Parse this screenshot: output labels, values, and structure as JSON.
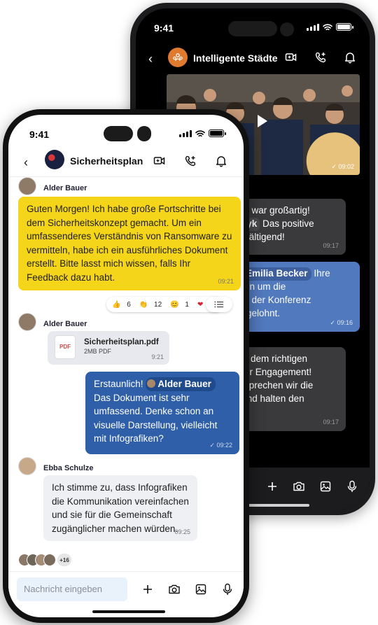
{
  "back_phone": {
    "status": {
      "time": "9:41"
    },
    "header": {
      "title": "Intelligente Städte"
    },
    "video": {
      "time": "09:02"
    },
    "messages": [
      {
        "line1": "enz war großartig!",
        "mention": "czyk",
        "line2_rest": "Das positive",
        "line3": "erwältigend!",
        "time": "09:17"
      },
      {
        "mention": "Emilia Becker",
        "line1_rest": "Ihre",
        "line2": "ngen um die",
        "line3": "tion der Konferenz",
        "line4": "ch gelohnt.",
        "time": "09:16"
      },
      {
        "line1": "Auf dem richtigen",
        "line2": "euer Engagement!",
        "line3": "besprechen wir die",
        "line4": "e und halten den",
        "time": "09:17"
      }
    ]
  },
  "front_phone": {
    "status": {
      "time": "9:41"
    },
    "header": {
      "title": "Sicherheitsplan"
    },
    "messages": {
      "m1": {
        "sender": "Alder Bauer",
        "text": "Guten Morgen! Ich habe große Fortschritte bei dem Sicherheitskonzept gemacht. Um ein umfassenderes Verständnis von Ransomware zu vermitteln, habe ich ein ausführliches Dokument erstellt. Bitte lasst mich wissen, falls Ihr Feedback dazu habt.",
        "time": "09:21",
        "reactions": [
          {
            "emoji": "👍",
            "count": "6"
          },
          {
            "emoji": "👏",
            "count": "12"
          },
          {
            "emoji": "😊",
            "count": "1"
          },
          {
            "emoji": "❤",
            "count": "1"
          }
        ]
      },
      "m2": {
        "sender": "Alder Bauer",
        "file_icon": "PDF",
        "file_name": "Sicherheitsplan.pdf",
        "file_meta": "2MB PDF",
        "time": "9:21"
      },
      "m3": {
        "prefix": "Erstaunlich!",
        "mention": "Alder Bauer",
        "text": "Das Dokument ist sehr umfassend. Denke schon an visuelle Darstellung, vielleicht mit Infografiken?",
        "time": "09:22"
      },
      "m4": {
        "sender": "Ebba Schulze",
        "text": "Ich stimme zu, dass Infografiken die Kommunikation vereinfachen und sie für die Gemeinschaft zugänglicher machen würden.",
        "time": "09:25"
      }
    },
    "readers_more": "+16",
    "input": {
      "placeholder": "Nachricht eingeben"
    }
  },
  "colors": {
    "yellow_bubble": "#f5d51a",
    "blue_bubble": "#2f5fa8",
    "dark_blue_bubble": "#5179be",
    "group_avatar": "#e07a2e"
  }
}
